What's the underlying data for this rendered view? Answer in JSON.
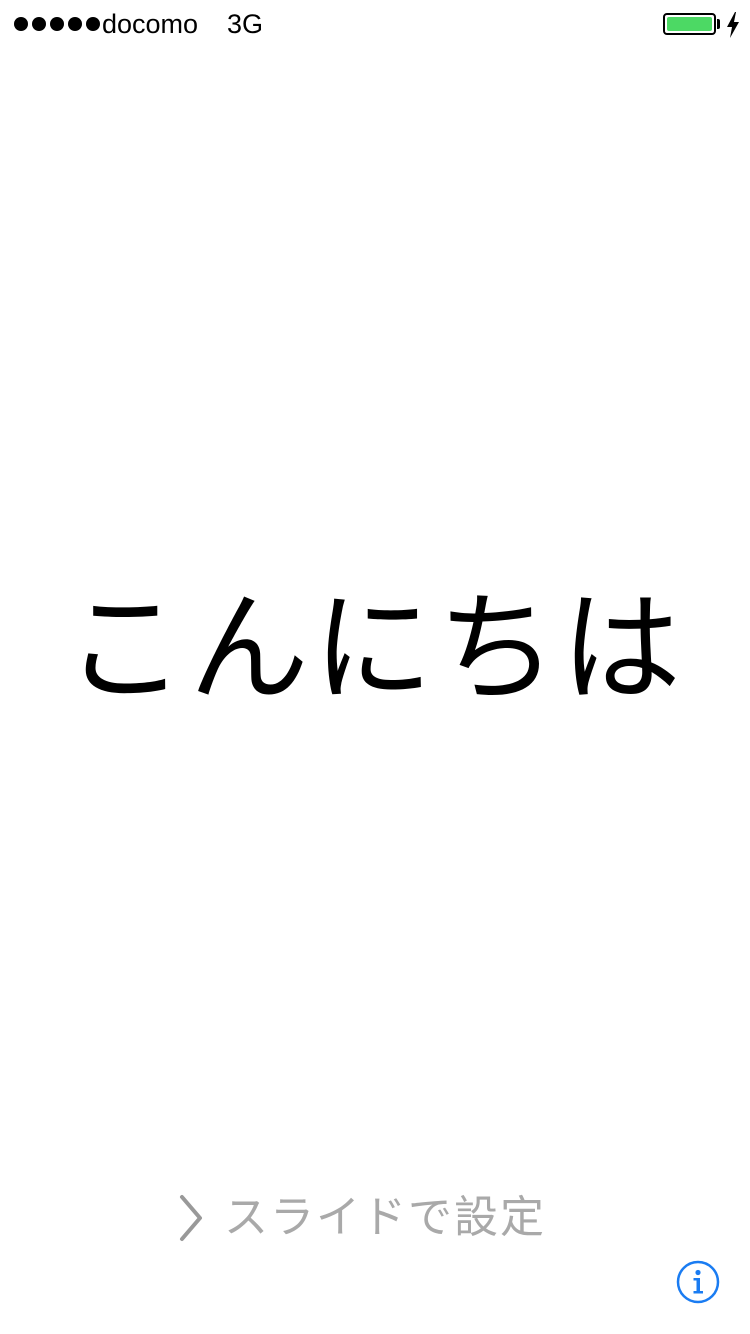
{
  "status_bar": {
    "signal_bars": 5,
    "carrier": "docomo",
    "network": "3G",
    "battery_level": 1.0,
    "charging": true,
    "icons": [
      "signal-icon",
      "battery-icon",
      "charging-icon"
    ]
  },
  "greeting": {
    "text": "こんにちは"
  },
  "slide_to_setup": {
    "label": "スライドで設定",
    "icon": "chevron-right-icon"
  },
  "info_button": {
    "icon": "info-icon"
  },
  "colors": {
    "background": "#ffffff",
    "text": "#000000",
    "battery_fill": "#4cd964",
    "slide_label": "#a9a9a9",
    "chevron": "#999999",
    "info_accent": "#1a7cf2"
  }
}
